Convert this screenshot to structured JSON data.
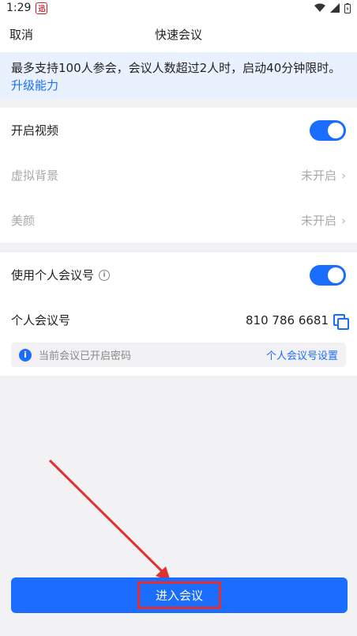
{
  "status_bar": {
    "time": "1:29",
    "badge_char": "迅",
    "icons": [
      "wifi-icon",
      "signal-icon",
      "battery-icon"
    ]
  },
  "nav": {
    "cancel": "取消",
    "title": "快速会议"
  },
  "notice": {
    "text": "最多支持100人参会，会议人数超过2人时，启动40分钟限时。",
    "link": "升级能力"
  },
  "settings1": {
    "video": {
      "label": "开启视频",
      "toggle_on": true
    },
    "virtual_bg": {
      "label": "虚拟背景",
      "value": "未开启"
    },
    "beauty": {
      "label": "美颜",
      "value": "未开启"
    }
  },
  "settings2": {
    "personal_id_toggle": {
      "label": "使用个人会议号",
      "toggle_on": true
    },
    "personal_id": {
      "label": "个人会议号",
      "value": "810 786 6681"
    },
    "password_notice": {
      "text": "当前会议已开启密码",
      "link": "个人会议号设置"
    }
  },
  "join_button": {
    "label": "进入会议"
  },
  "colors": {
    "accent": "#1a6dff",
    "annotation": "#e23030"
  }
}
